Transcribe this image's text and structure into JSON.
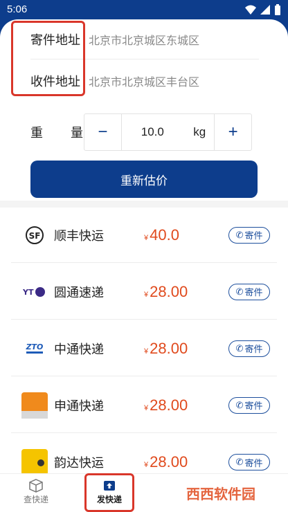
{
  "status_bar": {
    "time": "5:06"
  },
  "address": {
    "send_label": "寄件地址",
    "send_value": "北京市北京城区东城区",
    "receive_label": "收件地址",
    "receive_value": "北京市北京城区丰台区"
  },
  "weight": {
    "label_chars": [
      "重",
      "量"
    ],
    "minus": "−",
    "value": "10.0",
    "unit": "kg",
    "plus": "+"
  },
  "estimate_button": "重新估价",
  "companies": [
    {
      "name": "顺丰快运",
      "yen": "¥",
      "price": "40.0",
      "send": "寄件",
      "logo": "sf-logo"
    },
    {
      "name": "圆通速递",
      "yen": "¥",
      "price": "28.00",
      "send": "寄件",
      "logo": "yto-logo"
    },
    {
      "name": "中通快递",
      "yen": "¥",
      "price": "28.00",
      "send": "寄件",
      "logo": "zto-logo"
    },
    {
      "name": "申通快递",
      "yen": "¥",
      "price": "28.00",
      "send": "寄件",
      "logo": "sto-logo"
    },
    {
      "name": "韵达快运",
      "yen": "¥",
      "price": "28.00",
      "send": "寄件",
      "logo": "yunda-logo"
    }
  ],
  "tabs": [
    {
      "label": "查快递",
      "icon": "box-icon"
    },
    {
      "label": "发快递",
      "icon": "upload-box-icon"
    }
  ],
  "watermark": "西西软件园",
  "colors": {
    "brand": "#0d3d8c",
    "price": "#e04a1d",
    "highlight": "#d9362a"
  }
}
